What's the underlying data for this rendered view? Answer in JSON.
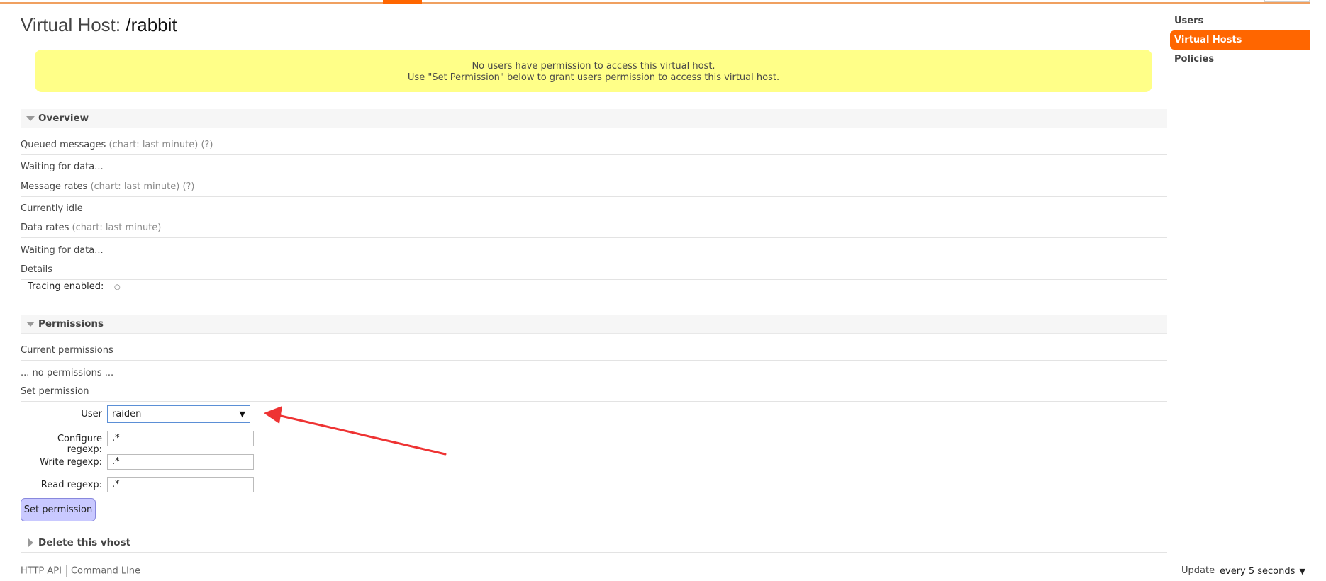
{
  "page": {
    "title_prefix": "Virtual Host:",
    "vhost_name": "/rabbit"
  },
  "warning": {
    "line1": "No users have permission to access this virtual host.",
    "line2": "Use \"Set Permission\" below to grant users permission to access this virtual host."
  },
  "overview": {
    "heading": "Overview",
    "queued_label": "Queued messages",
    "queued_meta": "(chart: last minute) (?)",
    "queued_status": "Waiting for data...",
    "rates_label": "Message rates",
    "rates_meta": "(chart: last minute) (?)",
    "rates_status": "Currently idle",
    "data_label": "Data rates",
    "data_meta": "(chart: last minute)",
    "data_status": "Waiting for data...",
    "details_label": "Details",
    "tracing_label": "Tracing enabled:",
    "tracing_value": "○"
  },
  "permissions": {
    "heading": "Permissions",
    "current_label": "Current permissions",
    "none_text": "... no permissions ...",
    "set_label": "Set permission",
    "user_label": "User",
    "user_value": "raiden",
    "configure_label": "Configure regexp:",
    "configure_value": ".*",
    "write_label": "Write regexp:",
    "write_value": ".*",
    "read_label": "Read regexp:",
    "read_value": ".*",
    "submit_label": "Set permission"
  },
  "delete_section": {
    "heading": "Delete this vhost"
  },
  "footer": {
    "http_api": "HTTP API",
    "command_line": "Command Line",
    "update_label": "Update",
    "update_value": "every 5 seconds"
  },
  "nav": {
    "items": [
      {
        "label": "Users",
        "active": false
      },
      {
        "label": "Virtual Hosts",
        "active": true
      },
      {
        "label": "Policies",
        "active": false
      }
    ]
  },
  "colors": {
    "accent": "#ff6600",
    "warning_bg": "#ffff88",
    "button_bg": "#c9c9ff",
    "annotation_arrow": "#ee3333"
  },
  "icons": {
    "collapse": "triangle-down-icon",
    "expand": "triangle-right-icon",
    "select_arrow": "▼"
  }
}
